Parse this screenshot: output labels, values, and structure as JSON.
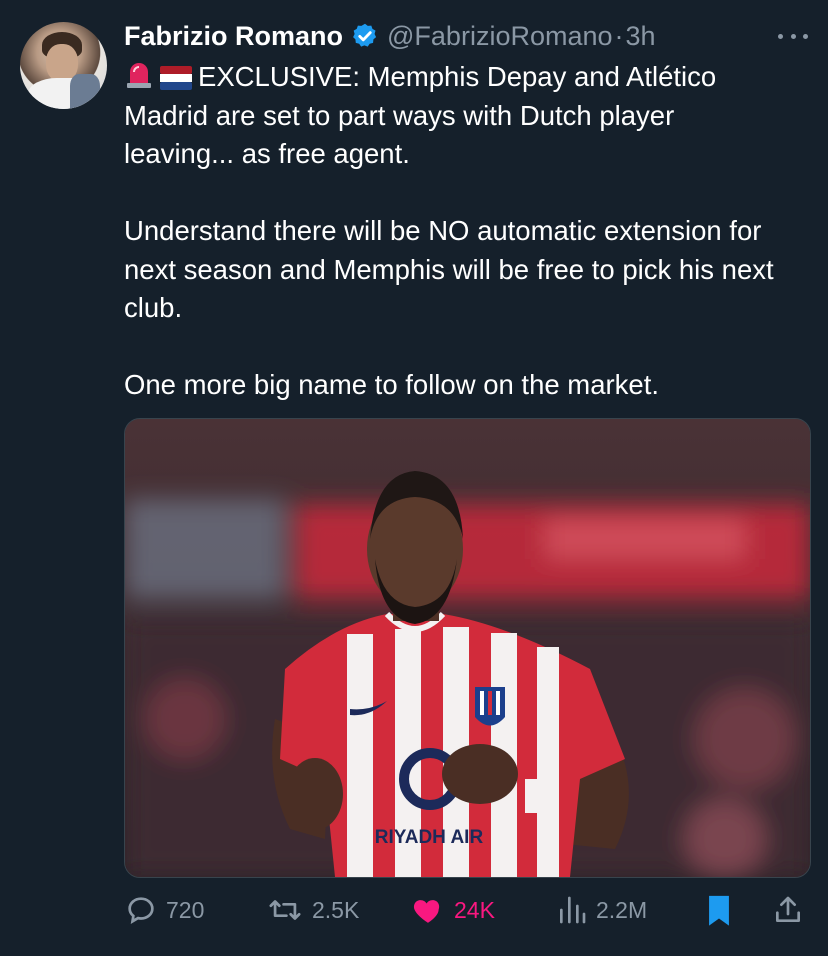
{
  "author": {
    "name": "Fabrizio Romano",
    "handle": "@FabrizioRomano",
    "separator": "·",
    "time": "3h"
  },
  "tweet": {
    "emojis": [
      "police-car-light-icon",
      "netherlands-flag-icon"
    ],
    "line1": "EXCLUSIVE: Memphis Depay and Atlético",
    "line2": "Madrid are set to part ways with Dutch player",
    "line3": "leaving... as free agent.",
    "para2": "Understand there will be NO automatic extension for next season and Memphis will be free to pick his next club.",
    "para3": "One more big name to follow on the market."
  },
  "media": {
    "sponsor_text": "RIYADH AIR"
  },
  "actions": {
    "replies": "720",
    "retweets": "2.5K",
    "likes": "24K",
    "views": "2.2M"
  },
  "colors": {
    "background": "#15202b",
    "muted": "#8b98a5",
    "like": "#f91880",
    "accent": "#1d9bf0"
  }
}
